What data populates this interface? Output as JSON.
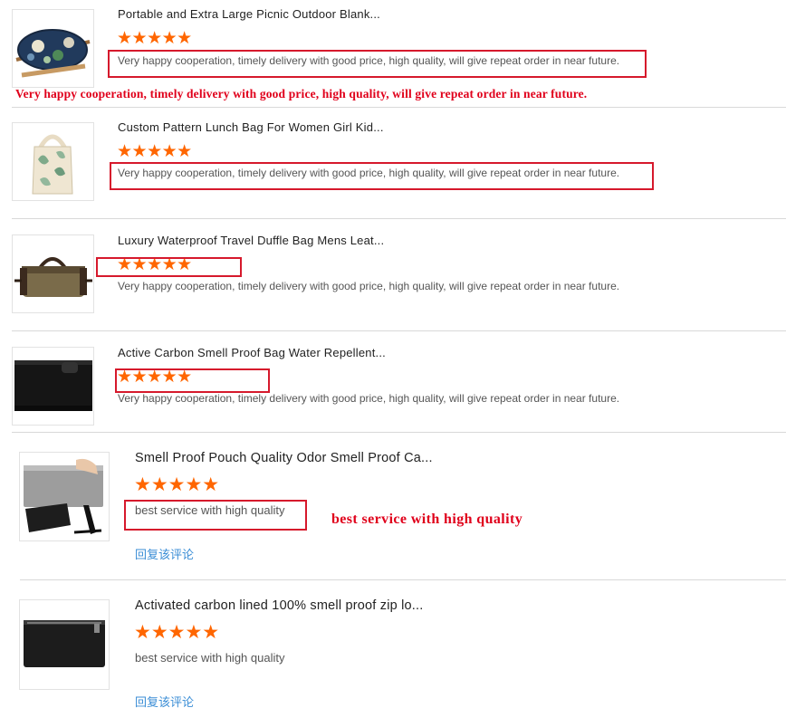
{
  "reviews": [
    {
      "title": "Portable and Extra Large Picnic Outdoor Blank...",
      "stars": "★★★★★",
      "comment": "Very happy cooperation, timely delivery with good price, high quality, will give repeat order in near future."
    },
    {
      "title": "Custom Pattern Lunch Bag For Women Girl Kid...",
      "stars": "★★★★★",
      "comment": "Very happy cooperation, timely delivery with good price, high quality, will give repeat order in near future."
    },
    {
      "title": "Luxury Waterproof Travel Duffle Bag Mens Leat...",
      "stars": "★★★★★",
      "comment": "Very happy cooperation, timely delivery with good price, high quality, will give repeat order in near future."
    },
    {
      "title": "Active Carbon Smell Proof Bag Water Repellent...",
      "stars": "★★★★★",
      "comment": "Very happy cooperation, timely delivery with good price, high quality, will give repeat order in near future."
    },
    {
      "title": "Smell Proof Pouch Quality Odor Smell Proof Ca...",
      "stars": "★★★★★",
      "comment": "best service with high quality",
      "reply": "回复该评论"
    },
    {
      "title": "Activated carbon lined 100% smell proof zip lo...",
      "stars": "★★★★★",
      "comment": "best service with high quality",
      "reply": "回复该评论"
    }
  ],
  "annotations": {
    "top": "Very happy cooperation, timely delivery with good price, high quality, will give repeat order in near future.",
    "middle": "best service with high quality"
  },
  "rating": {
    "review_1": 5,
    "review_2": 5,
    "review_3": 5,
    "review_4": 5,
    "review_5": 5,
    "review_6": 5
  },
  "colors": {
    "star": "#ff6600",
    "annotation_red": "#d6192c",
    "reply_link": "#3b8ed6"
  }
}
